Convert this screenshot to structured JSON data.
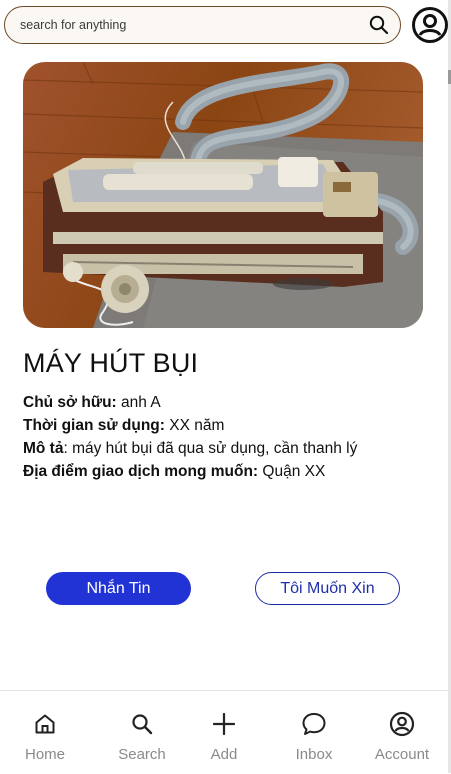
{
  "search": {
    "placeholder": "search for anything"
  },
  "item": {
    "title": "MÁY HÚT BỤI",
    "details": [
      {
        "label": "Chủ sở hữu:",
        "value": " anh A"
      },
      {
        "label": "Thời gian sử dụng:",
        "value": " XX năm"
      },
      {
        "label": "Mô tả",
        "value": ": máy hút bụi đã qua sử dụng, cần thanh lý"
      },
      {
        "label": "Địa điểm giao dịch mong muốn:",
        "value": " Quận XX"
      }
    ]
  },
  "actions": {
    "message_label": "Nhắn Tin",
    "request_label": "Tôi Muốn Xin"
  },
  "nav": {
    "items": [
      {
        "label": "Home",
        "icon": "home-icon"
      },
      {
        "label": "Search",
        "icon": "search-icon"
      },
      {
        "label": "Add",
        "icon": "plus-icon"
      },
      {
        "label": "Inbox",
        "icon": "chat-bubble-icon"
      },
      {
        "label": "Account",
        "icon": "user-circle-icon"
      }
    ]
  },
  "colors": {
    "accent": "#2233d6",
    "outline": "#1e2fa8",
    "search_border": "#6b4a28"
  }
}
